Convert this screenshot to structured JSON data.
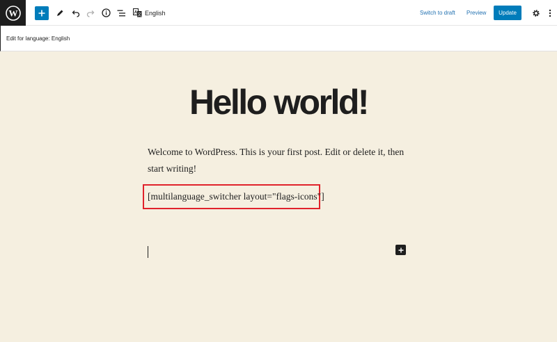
{
  "toolbar": {
    "language_label": "English",
    "switch_to_draft_label": "Switch to draft",
    "preview_label": "Preview",
    "update_label": "Update",
    "icons": [
      "wordpress-icon",
      "plus-icon",
      "pencil-icon",
      "undo-icon",
      "redo-icon",
      "info-icon",
      "list-view-icon",
      "translate-icon",
      "gear-icon",
      "more-vertical-icon"
    ],
    "accent_color": "#007cba"
  },
  "subbar": {
    "text": "Edit for language: English"
  },
  "post": {
    "title": "Hello world!",
    "paragraph": "Welcome to WordPress. This is your first post. Edit or delete it, then start writing!",
    "shortcode": "[multilanguage_switcher layout=\"flags-icons\"]"
  },
  "colors": {
    "canvas_background": "#f5efe0",
    "highlight_border": "#e0222b"
  }
}
